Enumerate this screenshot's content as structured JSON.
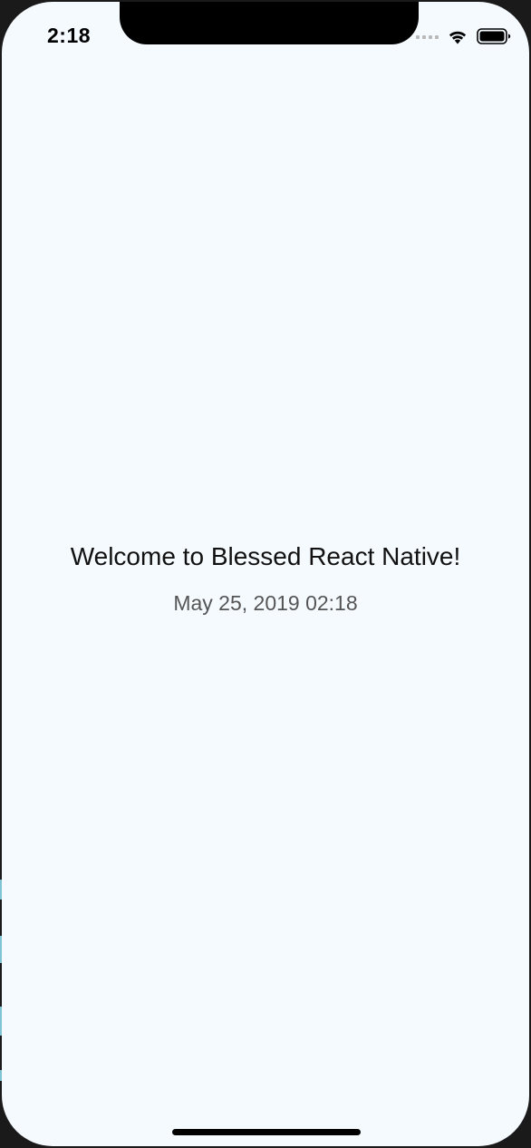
{
  "status_bar": {
    "time": "2:18",
    "icons": [
      "signal-dots-icon",
      "wifi-icon",
      "battery-icon"
    ]
  },
  "screen": {
    "welcome_text": "Welcome to Blessed React Native!",
    "datetime_text": "May 25, 2019 02:18",
    "background_color": "#f5faff",
    "text_color": "#111111",
    "secondary_text_color": "#555555"
  }
}
